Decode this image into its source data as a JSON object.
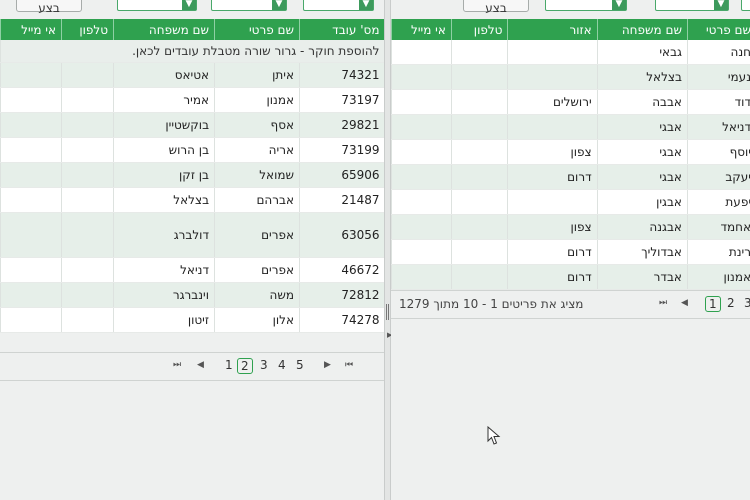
{
  "toolbar": {
    "button_label": "בצע"
  },
  "left_grid": {
    "columns": [
      "מס' עובד",
      "שם פרטי",
      "שם משפחה",
      "טלפון",
      "אי מייל"
    ],
    "group_hint": "להוספת חוקר - גרור שורה מטבלת עובדים לכאן.",
    "rows": [
      [
        "74321",
        "איתן",
        "אטיאס",
        "",
        ""
      ],
      [
        "73197",
        "אמנון",
        "אמיר",
        "",
        ""
      ],
      [
        "29821",
        "אסף",
        "בוקשטיין",
        "",
        ""
      ],
      [
        "73199",
        "אריה",
        "בן הרוש",
        "",
        ""
      ],
      [
        "65906",
        "שמואל",
        "בן זקן",
        "",
        ""
      ],
      [
        "21487",
        "אברהם",
        "בצלאל",
        "",
        ""
      ],
      [
        "63056",
        "אפרים",
        "דולברג",
        "",
        ""
      ],
      [
        "46672",
        "אפרים",
        "דניאל",
        "",
        ""
      ],
      [
        "72812",
        "משה",
        "וינברגר",
        "",
        ""
      ],
      [
        "74278",
        "אלון",
        "זיטון",
        "",
        ""
      ]
    ],
    "pager": {
      "pages": [
        "1",
        "2",
        "3",
        "4",
        "5"
      ],
      "current": "2"
    }
  },
  "right_grid": {
    "columns": [
      "שם פרטי",
      "שם משפחה",
      "אזור",
      "טלפון",
      "אי מייל"
    ],
    "rows": [
      [
        "חנה",
        "גבאי",
        "",
        "",
        ""
      ],
      [
        "נעמי",
        "בצלאל",
        "",
        "",
        ""
      ],
      [
        "דוד",
        "אבבה",
        "ירושלים",
        "",
        ""
      ],
      [
        "דניאל",
        "אבגי",
        "",
        "",
        ""
      ],
      [
        "יוסף",
        "אבגי",
        "צפון",
        "",
        ""
      ],
      [
        "יעקב",
        "אבגי",
        "דרום",
        "",
        ""
      ],
      [
        "יפעת",
        "אבגין",
        "",
        "",
        ""
      ],
      [
        "אחמד",
        "אבגנה",
        "צפון",
        "",
        ""
      ],
      [
        "רינת",
        "אבדוליך",
        "דרום",
        "",
        ""
      ],
      [
        "אמנון",
        "אבדר",
        "דרום",
        "",
        ""
      ]
    ],
    "pager": {
      "pages": [
        "1",
        "2",
        "3"
      ],
      "current": "1",
      "info": "מציג את פריטים 1 - 10 מתוך 1279"
    }
  },
  "icons": {
    "first": "⏮",
    "prev": "◀",
    "next": "▶",
    "last": "⏭",
    "dropdown": "chevron-down-icon"
  },
  "colors": {
    "header": "#2fa14f",
    "alt_row": "#e6efe9",
    "accent_border": "#49a86a"
  }
}
